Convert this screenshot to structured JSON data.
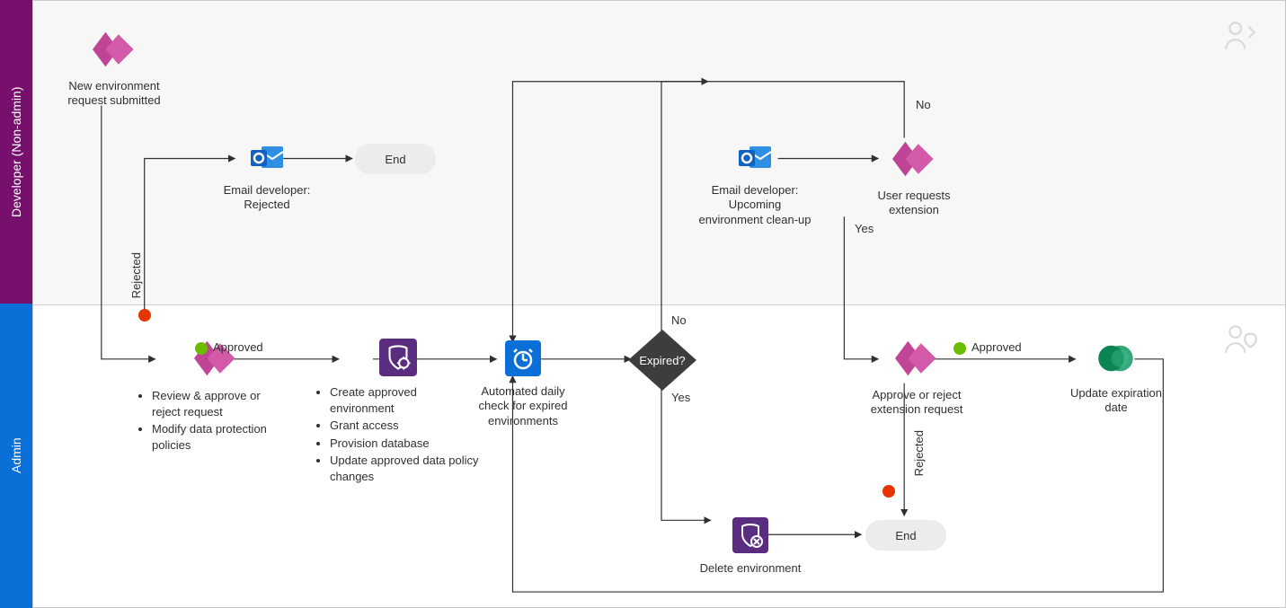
{
  "lanes": {
    "developer": "Developer (Non-admin)",
    "admin": "Admin"
  },
  "nodes": {
    "new_request": "New environment request submitted",
    "email_rejected": "Email developer: Rejected",
    "end1": "End",
    "review": {
      "b1": "Review & approve or reject request",
      "b2": "Modify data protection policies"
    },
    "create_env": {
      "b1": "Create approved environment",
      "b2": "Grant access",
      "b3": "Provision database",
      "b4": "Update approved data policy changes"
    },
    "daily_check": "Automated daily check for expired environments",
    "expired_q": "Expired?",
    "email_cleanup": "Email developer: Upcoming environment clean-up",
    "user_ext": "User requests extension",
    "approve_ext": "Approve or reject extension request",
    "update_exp": "Update expiration date",
    "delete_env": "Delete environment",
    "end2": "End"
  },
  "labels": {
    "approved": "Approved",
    "rejected_v": "Rejected",
    "no": "No",
    "yes": "Yes",
    "approved2": "Approved",
    "rejected_v2": "Rejected"
  },
  "colors": {
    "devLane": "#77106c",
    "adminLane": "#0a6fd7",
    "approvedDot": "#6cbd00",
    "rejectedDot": "#e43400",
    "powerapps": "#b62584",
    "outlook": "#1061c3",
    "azure_purple": "#5b2d81",
    "azure_blue": "#0a6fd7",
    "update_green": "#0d8453"
  }
}
